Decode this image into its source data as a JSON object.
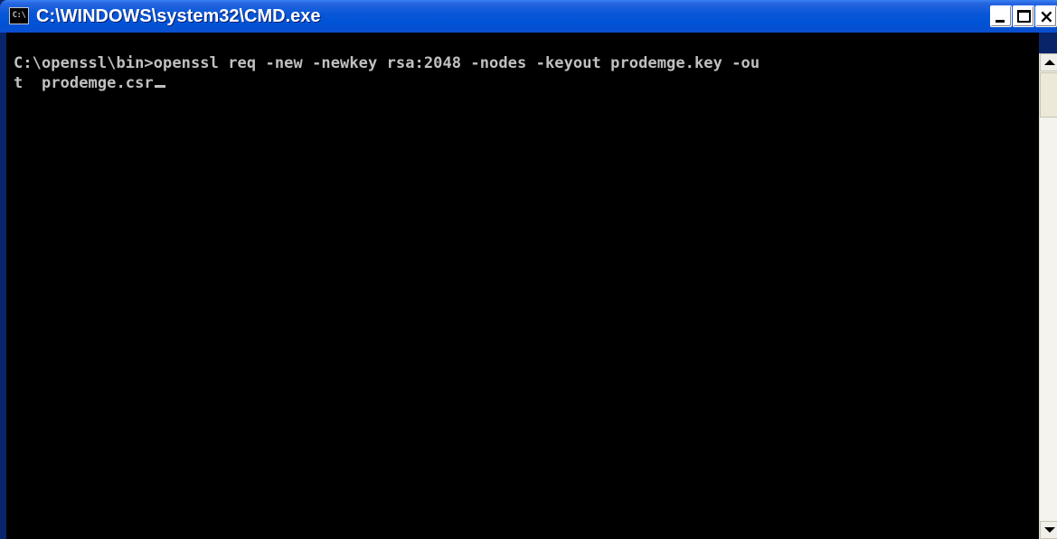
{
  "window": {
    "title": "C:\\WINDOWS\\system32\\CMD.exe",
    "icon_text": "C:\\",
    "icon": "cmd-icon"
  },
  "titlebar_buttons": {
    "minimize": "minimize-icon",
    "maximize": "maximize-icon",
    "close_label": "×"
  },
  "console": {
    "line1": "C:\\openssl\\bin>openssl req -new -newkey rsa:2048 -nodes -keyout prodemge.key -ou",
    "line2": "t  prodemge.csr"
  },
  "colors": {
    "titlebar": "#0053d6",
    "console_bg": "#000000",
    "console_fg": "#c0c0c0"
  }
}
